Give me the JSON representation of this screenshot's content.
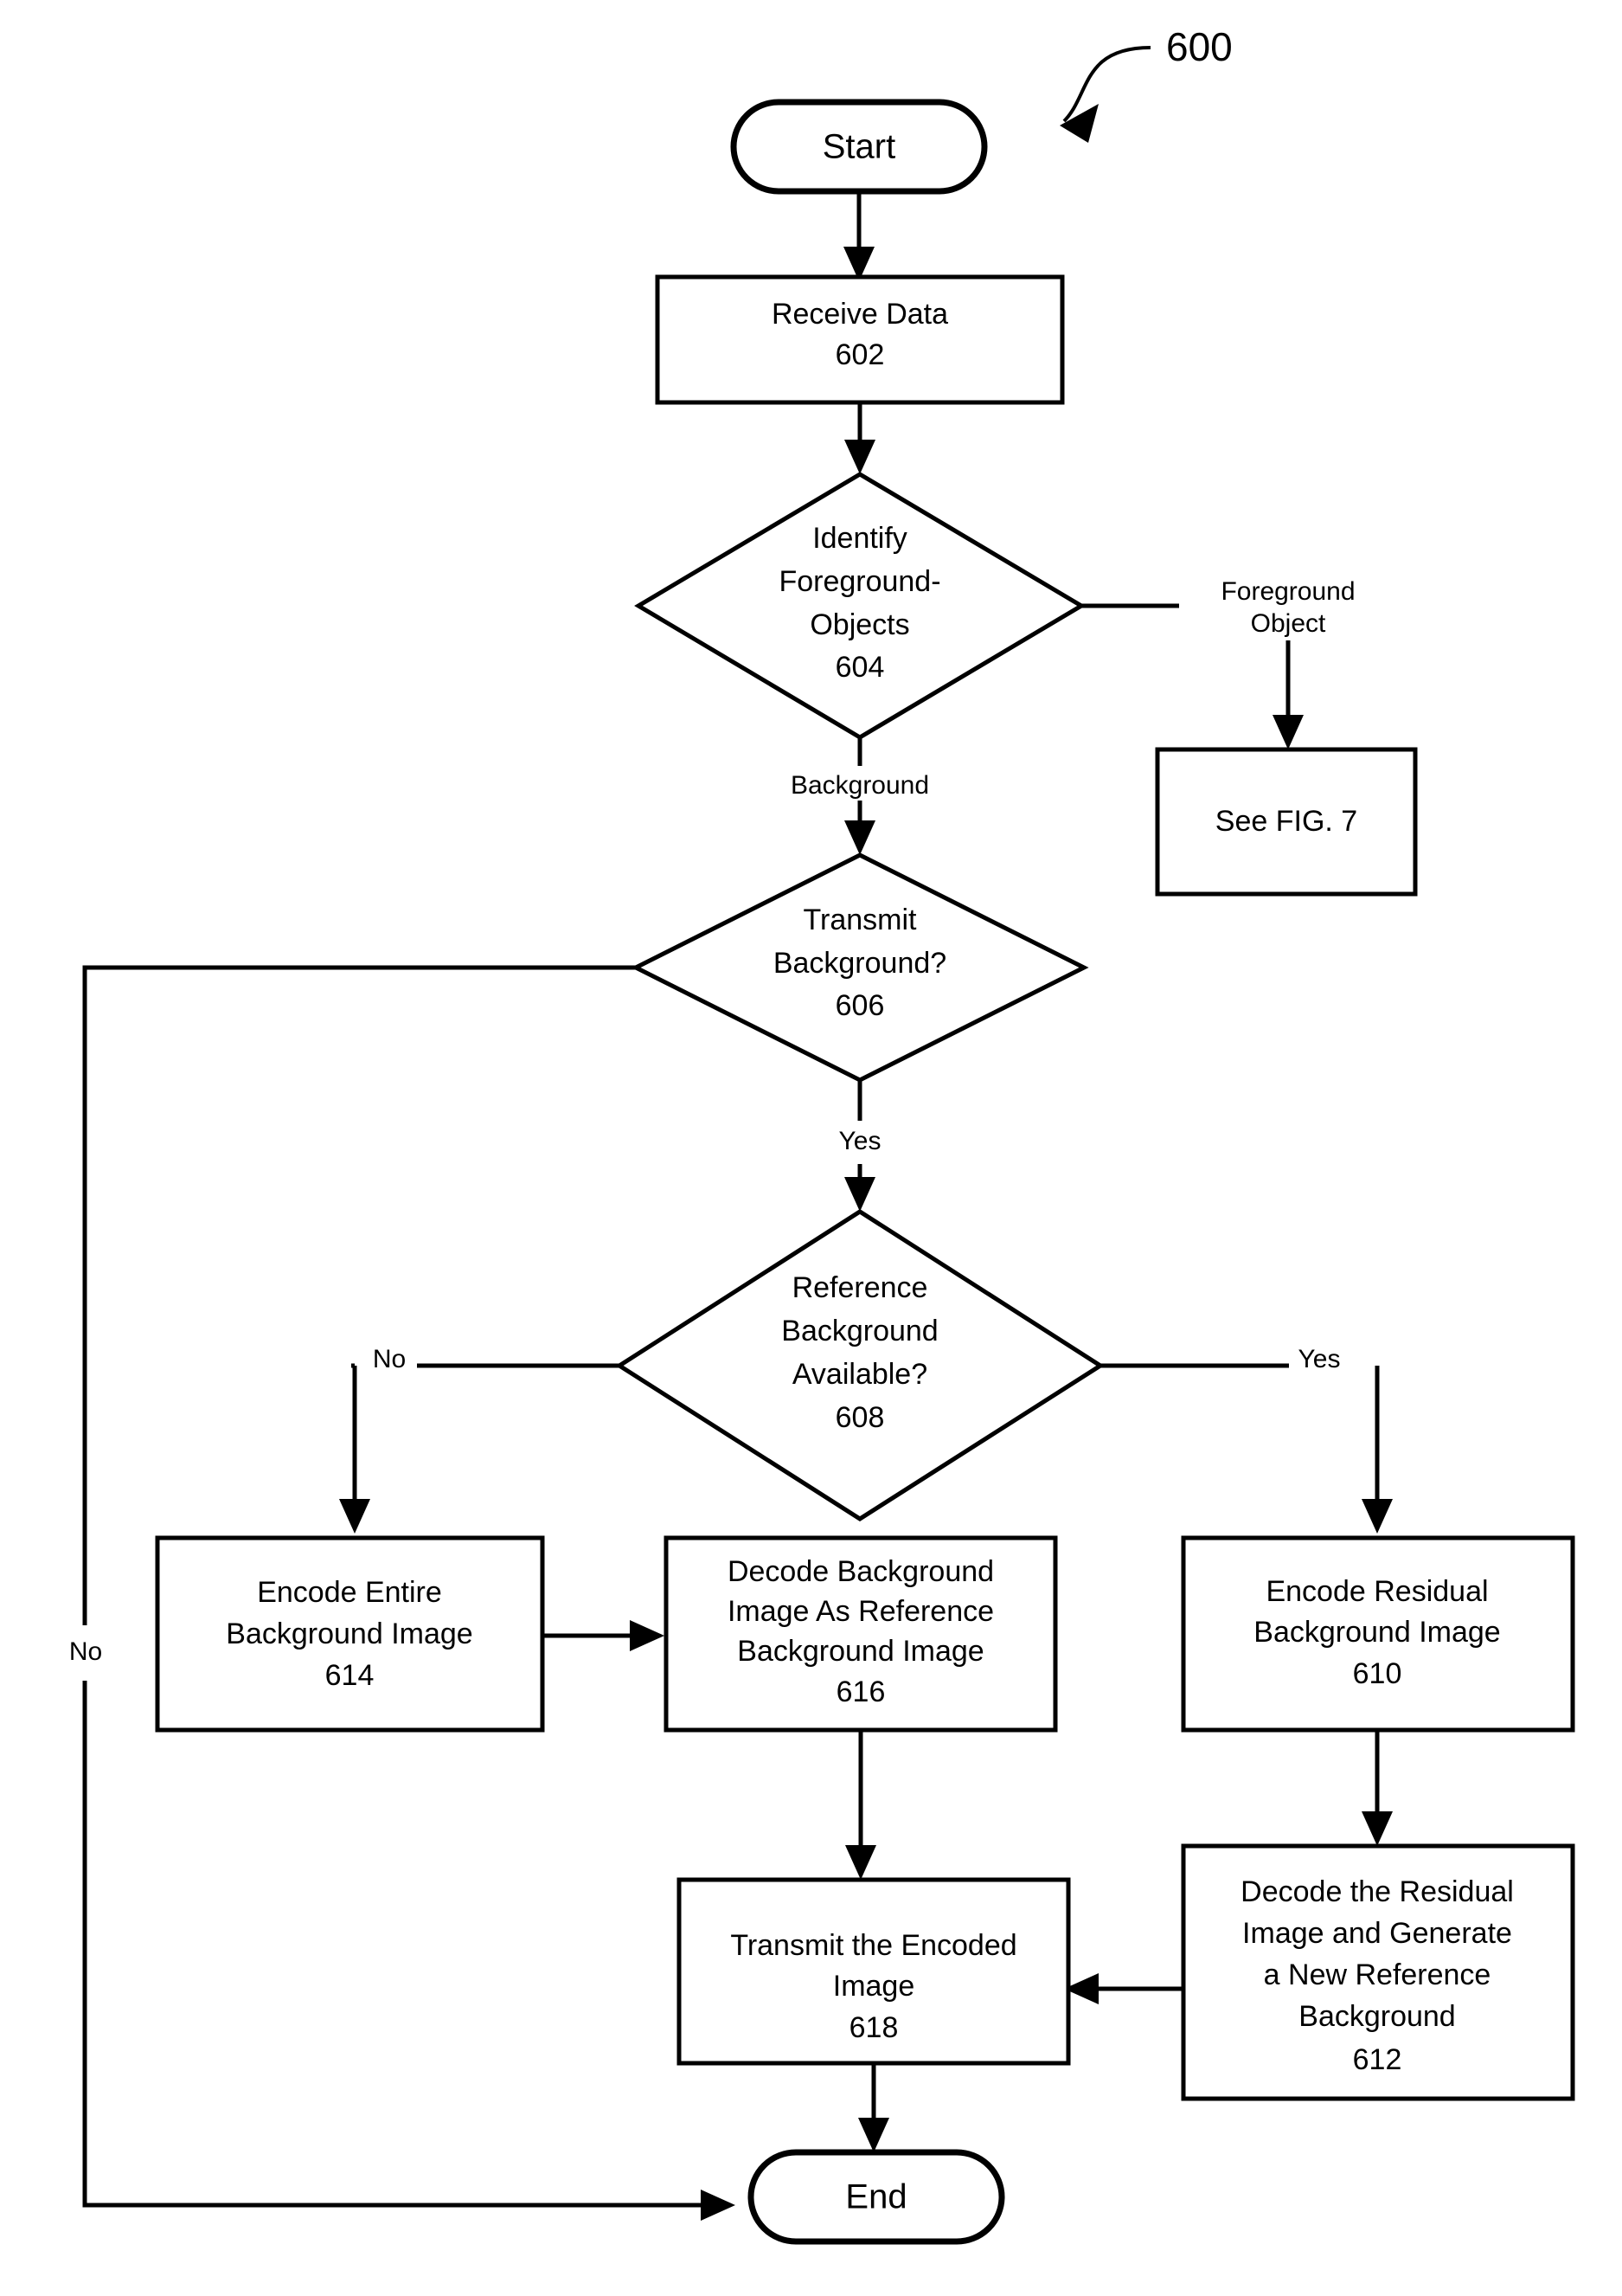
{
  "figure": {
    "label": "600"
  },
  "nodes": {
    "start": {
      "label": "Start",
      "shape": "terminator"
    },
    "receive_data": {
      "line1": "Receive Data",
      "ref": "602",
      "shape": "process"
    },
    "identify_foreground": {
      "line1": "Identify",
      "line2": "Foreground-",
      "line3": "Objects",
      "ref": "604",
      "shape": "decision"
    },
    "see_fig7": {
      "line1": "See FIG. 7",
      "shape": "process"
    },
    "transmit_background": {
      "line1": "Transmit",
      "line2": "Background?",
      "ref": "606",
      "shape": "decision"
    },
    "reference_background": {
      "line1": "Reference",
      "line2": "Background",
      "line3": "Available?",
      "ref": "608",
      "shape": "decision"
    },
    "encode_entire": {
      "line1": "Encode Entire",
      "line2": "Background Image",
      "ref": "614",
      "shape": "process"
    },
    "decode_background": {
      "line1": "Decode Background",
      "line2": "Image As Reference",
      "line3": "Background Image",
      "ref": "616",
      "shape": "process"
    },
    "encode_residual": {
      "line1": "Encode Residual",
      "line2": "Background Image",
      "ref": "610",
      "shape": "process"
    },
    "decode_residual": {
      "line1": "Decode the Residual",
      "line2": "Image and Generate",
      "line3": "a New Reference",
      "line4": "Background",
      "ref": "612",
      "shape": "process"
    },
    "transmit_encoded": {
      "line1": "Transmit the Encoded",
      "line2": "Image",
      "ref": "618",
      "shape": "process"
    },
    "end": {
      "label": "End",
      "shape": "terminator"
    }
  },
  "edge_labels": {
    "foreground_object_1": "Foreground",
    "foreground_object_2": "Object",
    "background": "Background",
    "transmit_yes": "Yes",
    "transmit_no": "No",
    "reference_no": "No",
    "reference_yes": "Yes"
  },
  "colors": {
    "stroke": "#000000",
    "fill": "#ffffff",
    "text": "#000000"
  }
}
